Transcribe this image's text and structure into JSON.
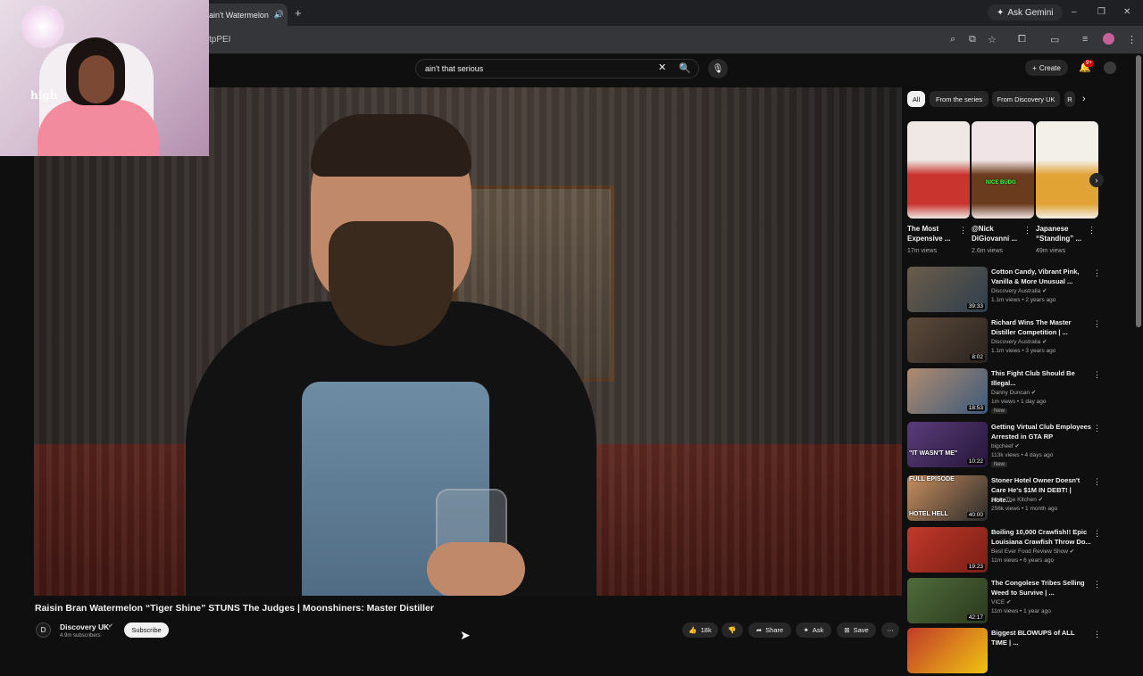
{
  "browser": {
    "tab_title": "ain't Watermelon",
    "new_tab": "+",
    "ask_gemini": "Ask Gemini",
    "url": "tpPEI",
    "minimize": "–",
    "restore": "❐",
    "close": "✕"
  },
  "yt": {
    "search_value": "ain't that serious",
    "create_label": "Create",
    "notification_count": "9+"
  },
  "video": {
    "title": "Raisin Bran Watermelon “Tiger Shine” STUNS The Judges | Moonshiners: Master Distiller",
    "channel": "Discovery UK",
    "subscribers": "4.9m subscribers",
    "subscribe_label": "Subscribe",
    "likes": "18k",
    "share_label": "Share",
    "ask_label": "Ask",
    "save_label": "Save"
  },
  "webcam": {
    "shirt_text": "high"
  },
  "chips": [
    "All",
    "From the series",
    "From Discovery UK",
    "R"
  ],
  "shorts": [
    {
      "title": "The Most Expensive ...",
      "views": "17m views",
      "color": "#c9342f",
      "bg": "#efe8e4"
    },
    {
      "title": "@Nick DiGiovanni ...",
      "views": "2.6m views",
      "color": "#6b3b1d",
      "bg": "#f1e4e6",
      "tag": "NICE BUDG"
    },
    {
      "title": "Japanese “Standing” ...",
      "views": "49m views",
      "color": "#e2a335",
      "bg": "#f3efe9"
    }
  ],
  "recs": [
    {
      "title": "Cotton Candy, Vibrant Pink, Vanilla & More Unusual ...",
      "channel": "Discovery Australia ✔",
      "meta": "1.1m views • 2 years ago",
      "duration": "39:33",
      "c1": "#6b5c4a",
      "c2": "#2e3f4c"
    },
    {
      "title": "Richard Wins The Master Distiller Competition | ...",
      "channel": "Discovery Australia ✔",
      "meta": "1.1m views • 3 years ago",
      "duration": "8:02",
      "c1": "#5c4a3a",
      "c2": "#2a2320"
    },
    {
      "title": "This Fight Club Should Be Illegal...",
      "channel": "Danny Duncan ✔",
      "meta": "1m views • 1 day ago",
      "duration": "18:53",
      "c1": "#b08b70",
      "c2": "#3c5a7a",
      "new": "New"
    },
    {
      "title": "Getting Virtual Club Employees Arrested in GTA RP",
      "channel": "bigcheef ✔",
      "meta": "113k views • 4 days ago",
      "duration": "10:22",
      "c1": "#5a3c7a",
      "c2": "#26173a",
      "new": "New",
      "tag": "\"IT WASN'T ME\""
    },
    {
      "title": "Stoner Hotel Owner Doesn't Care He's $1M IN DEBT! | Hote...",
      "channel": "All In The Kitchen ✔",
      "meta": "256k views • 1 month ago",
      "duration": "40:00",
      "c1": "#c98f5f",
      "c2": "#2a2a2a",
      "tag": "FULL EPISODE",
      "tag2": "HOTEL HELL"
    },
    {
      "title": "Boiling 10,000 Crawfish!! Epic Louisiana Crawfish Throw Do...",
      "channel": "Best Ever Food Review Show ✔",
      "meta": "11m views • 6 years ago",
      "duration": "19:23",
      "c1": "#c0392b",
      "c2": "#7a1e14"
    },
    {
      "title": "The Congolese Tribes Selling Weed to Survive | ...",
      "channel": "VICE ✔",
      "meta": "11m views • 1 year ago",
      "duration": "42:17",
      "c1": "#4f6b3a",
      "c2": "#2c3a1f"
    },
    {
      "title": "Biggest BLOWUPS of ALL TIME | ...",
      "channel": "",
      "meta": "",
      "duration": "",
      "c1": "#c0392b",
      "c2": "#f1c40f"
    }
  ]
}
